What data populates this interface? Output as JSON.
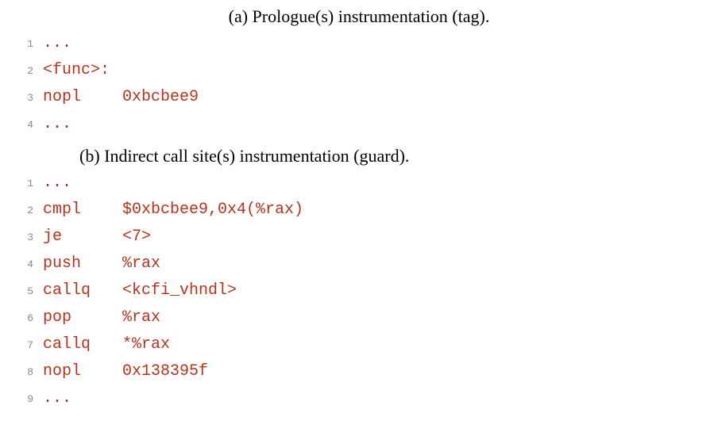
{
  "caption_a": "(a) Prologue(s) instrumentation (tag).",
  "caption_b": "(b) Indirect call site(s) instrumentation (guard).",
  "block_a": {
    "lines": [
      {
        "num": "1",
        "mnemonic": "...",
        "operand": ""
      },
      {
        "num": "2",
        "mnemonic": "<func>:",
        "operand": ""
      },
      {
        "num": "3",
        "mnemonic": "nopl",
        "operand": "0xbcbee9"
      },
      {
        "num": "4",
        "mnemonic": "...",
        "operand": ""
      }
    ]
  },
  "block_b": {
    "lines": [
      {
        "num": "1",
        "mnemonic": "...",
        "operand": ""
      },
      {
        "num": "2",
        "mnemonic": "cmpl",
        "operand": "$0xbcbee9,0x4(%rax)"
      },
      {
        "num": "3",
        "mnemonic": "je",
        "operand": "<7>"
      },
      {
        "num": "4",
        "mnemonic": "push",
        "operand": "%rax"
      },
      {
        "num": "5",
        "mnemonic": "callq",
        "operand": "<kcfi_vhndl>"
      },
      {
        "num": "6",
        "mnemonic": "pop",
        "operand": "%rax"
      },
      {
        "num": "7",
        "mnemonic": "callq",
        "operand": "*%rax"
      },
      {
        "num": "8",
        "mnemonic": "nopl",
        "operand": "0x138395f"
      },
      {
        "num": "9",
        "mnemonic": "...",
        "operand": ""
      }
    ]
  }
}
